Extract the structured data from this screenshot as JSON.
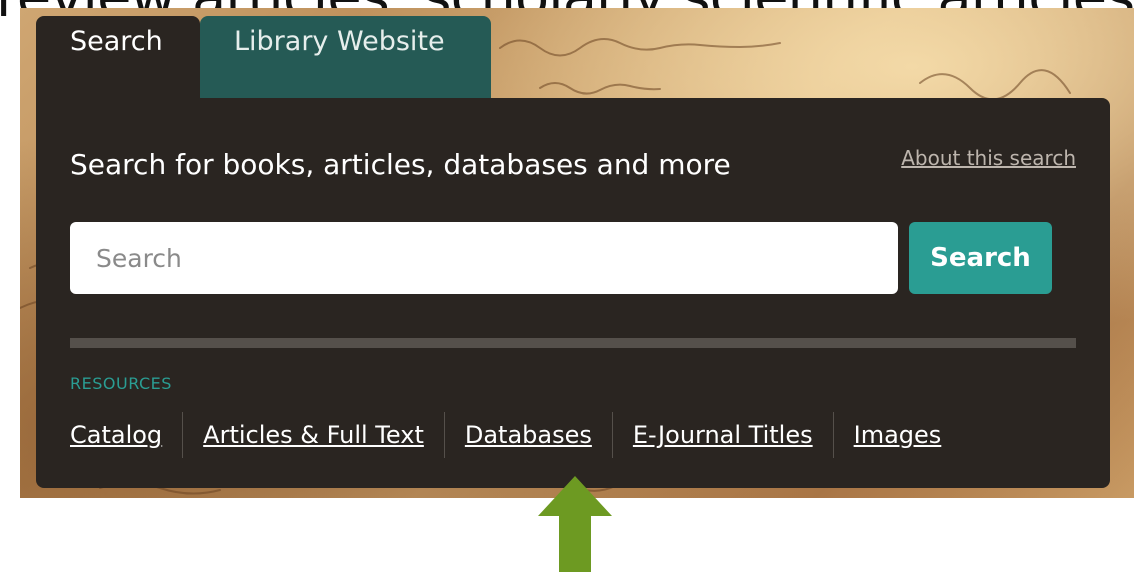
{
  "slide_text_cutoff": "review articles, scholarly scientific articles",
  "tabs": [
    {
      "label": "Search",
      "active": true
    },
    {
      "label": "Library Website",
      "active": false
    }
  ],
  "panel": {
    "heading": "Search for books, articles, databases and more",
    "about_link": "About this search"
  },
  "search": {
    "placeholder": "Search",
    "value": "",
    "button_label": "Search"
  },
  "resources": {
    "label": "RESOURCES",
    "links": [
      "Catalog",
      "Articles & Full Text",
      "Databases",
      "E-Journal Titles",
      "Images"
    ]
  },
  "annotation": {
    "arrow_icon": "up-arrow-icon",
    "arrow_color": "#6d9a22",
    "points_to": "Databases"
  },
  "colors": {
    "panel_bg": "#2a2521",
    "library_tab_bg": "#255a55",
    "accent": "#2a9d93"
  }
}
